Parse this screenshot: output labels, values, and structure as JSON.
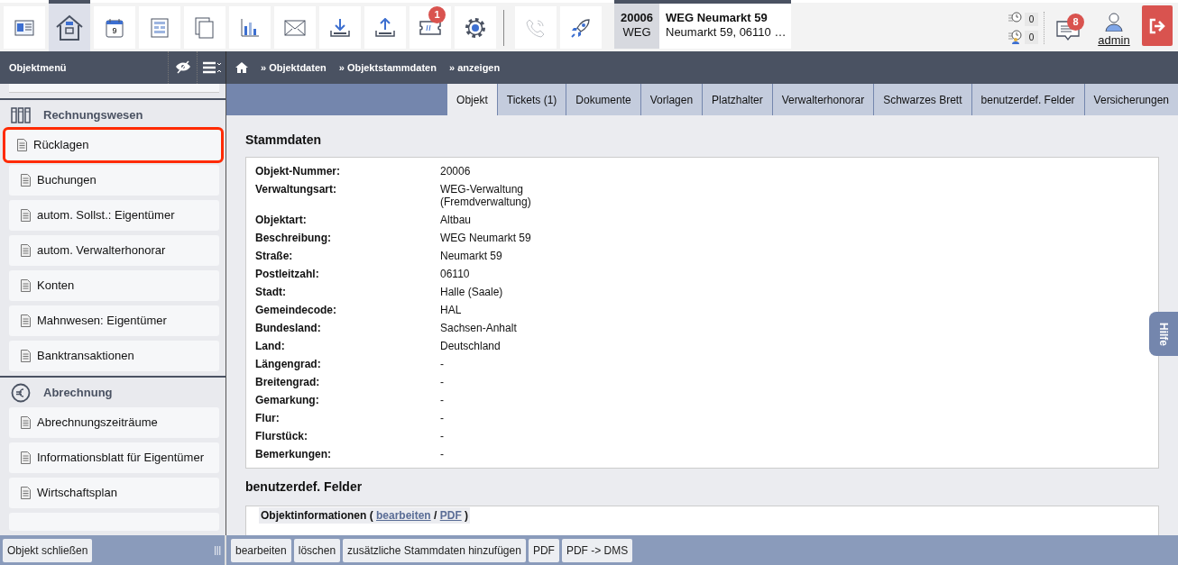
{
  "toolbar": [
    {
      "kind": "card",
      "selected": false,
      "disabled": false
    },
    {
      "kind": "house",
      "selected": true,
      "disabled": false
    },
    {
      "kind": "calendar",
      "label": "9",
      "selected": false,
      "disabled": false
    },
    {
      "kind": "form",
      "selected": false,
      "disabled": false
    },
    {
      "kind": "documents",
      "selected": false,
      "disabled": false
    },
    {
      "kind": "chart",
      "selected": false,
      "disabled": false
    },
    {
      "kind": "mail",
      "selected": false,
      "disabled": false
    },
    {
      "kind": "download",
      "selected": false,
      "disabled": false
    },
    {
      "kind": "upload",
      "selected": false,
      "disabled": false
    },
    {
      "kind": "ticket",
      "badge": "1",
      "selected": false,
      "disabled": false
    },
    {
      "kind": "gear",
      "selected": false,
      "disabled": false
    },
    {
      "kind": "separator"
    },
    {
      "kind": "phone",
      "selected": false,
      "disabled": true
    },
    {
      "kind": "rocket",
      "selected": false,
      "disabled": false
    }
  ],
  "object_header": {
    "number": "20006",
    "type": "WEG",
    "title": "WEG Neumarkt 59",
    "address": "Neumarkt 59, 06110 …"
  },
  "counters": [
    {
      "kind": "clock",
      "value": "0"
    },
    {
      "kind": "clock-user",
      "value": "0"
    }
  ],
  "messages": {
    "badge": "8"
  },
  "user": {
    "name": "admin"
  },
  "sidebar": {
    "title": "Objektmenü",
    "sections": [
      {
        "kind": "binders",
        "title": "Rechnungswesen",
        "items": [
          {
            "label": "Rücklagen",
            "highlighted": true
          },
          {
            "label": "Buchungen",
            "highlighted": false
          },
          {
            "label": "autom. Sollst.: Eigentümer",
            "highlighted": false
          },
          {
            "label": "autom. Verwalterhonorar",
            "highlighted": false
          },
          {
            "label": "Konten",
            "highlighted": false
          },
          {
            "label": "Mahnwesen: Eigentümer",
            "highlighted": false
          },
          {
            "label": "Banktransaktionen",
            "highlighted": false
          }
        ]
      },
      {
        "kind": "euro",
        "title": "Abrechnung",
        "items": [
          {
            "label": "Abrechnungszeiträume",
            "highlighted": false
          },
          {
            "label": "Informationsblatt für Eigentümer",
            "highlighted": false
          },
          {
            "label": "Wirtschaftsplan",
            "highlighted": false
          }
        ]
      }
    ],
    "close_button": "Objekt schließen",
    "handle": "|||"
  },
  "breadcrumb": [
    "» Objektdaten",
    "» Objektstammdaten",
    "» anzeigen"
  ],
  "tabs": [
    {
      "label": "Objekt",
      "selected": true
    },
    {
      "label": "Tickets (1)",
      "selected": false
    },
    {
      "label": "Dokumente",
      "selected": false
    },
    {
      "label": "Vorlagen",
      "selected": false
    },
    {
      "label": "Platzhalter",
      "selected": false
    },
    {
      "label": "Verwalterhonorar",
      "selected": false
    },
    {
      "label": "Schwarzes Brett",
      "selected": false
    },
    {
      "label": "benutzerdef. Felder",
      "selected": false
    },
    {
      "label": "Versicherungen",
      "selected": false
    }
  ],
  "stammdaten": {
    "title": "Stammdaten",
    "rows": [
      {
        "label": "Objekt-Nummer:",
        "value": "20006"
      },
      {
        "label": "Verwaltungsart:",
        "value": "WEG-Verwaltung\n(Fremdverwaltung)"
      },
      {
        "label": "Objektart:",
        "value": "Altbau"
      },
      {
        "label": "Beschreibung:",
        "value": "WEG Neumarkt 59"
      },
      {
        "label": "Straße:",
        "value": "Neumarkt 59"
      },
      {
        "label": "Postleitzahl:",
        "value": "06110"
      },
      {
        "label": "Stadt:",
        "value": "Halle (Saale)"
      },
      {
        "label": "Gemeindecode:",
        "value": "HAL"
      },
      {
        "label": "Bundesland:",
        "value": "Sachsen-Anhalt"
      },
      {
        "label": "Land:",
        "value": "Deutschland"
      },
      {
        "label": "Längengrad:",
        "value": "-"
      },
      {
        "label": "Breitengrad:",
        "value": "-"
      },
      {
        "label": "Gemarkung:",
        "value": "-"
      },
      {
        "label": "Flur:",
        "value": "-"
      },
      {
        "label": "Flurstück:",
        "value": "-"
      },
      {
        "label": "Bemerkungen:",
        "value": "-"
      }
    ]
  },
  "custom_fields": {
    "title": "benutzerdef. Felder",
    "legend": "Objektinformationen (",
    "edit_link": "bearbeiten",
    "slash": "/",
    "pdf_link": "PDF",
    "legend_end": ")"
  },
  "help_tab": "Hilfe",
  "actions": [
    "bearbeiten",
    "löschen",
    "zusätzliche Stammdaten hinzufügen",
    "PDF",
    "PDF -> DMS"
  ]
}
